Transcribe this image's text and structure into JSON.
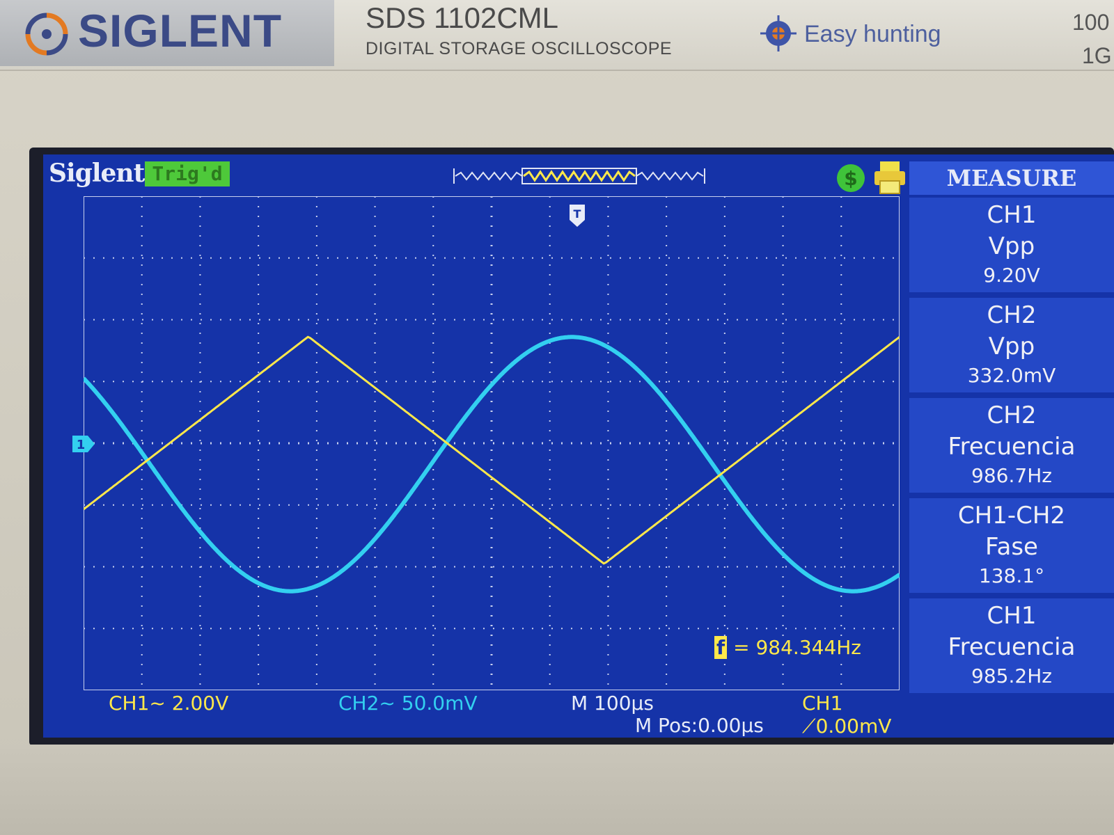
{
  "device": {
    "brand": "SIGLENT",
    "model": "SDS 1102CML",
    "subtitle": "DIGITAL STORAGE OSCILLOSCOPE",
    "feature": "Easy hunting",
    "corner_top": "100",
    "corner_bottom": "1G"
  },
  "screen": {
    "logo": "Siglent",
    "trigger_status": "Trig'd",
    "trigger_marker": "T",
    "ch1_ground_marker": "1",
    "freq_counter": "984.344Hz",
    "freq_counter_icon": "f"
  },
  "measure": {
    "title": "MEASURE",
    "items": [
      {
        "source": "CH1",
        "name": "Vpp",
        "value": "9.20V"
      },
      {
        "source": "CH2",
        "name": "Vpp",
        "value": "332.0mV"
      },
      {
        "source": "CH2",
        "name": "Frecuencia",
        "value": "986.7Hz"
      },
      {
        "source": "CH1-CH2",
        "name": "Fase",
        "value": "138.1°"
      },
      {
        "source": "CH1",
        "name": "Frecuencia",
        "value": "985.2Hz"
      }
    ]
  },
  "status": {
    "ch1_scale": "CH1~ 2.00V",
    "ch2_scale": "CH2~ 50.0mV",
    "timebase": "M 100μs",
    "position": "M Pos:0.00μs",
    "trigger": "CH1 ⟋0.00mV"
  },
  "colors": {
    "ch1": "#ffe84a",
    "ch2": "#33d0f0",
    "screen_bg": "#1533a8",
    "grid": "#c8d0ee"
  },
  "waveforms": {
    "grid_divisions": {
      "x": 14,
      "y": 8
    },
    "ch1": {
      "shape": "triangle",
      "volts_per_div": 2.0,
      "vpp": 9.2,
      "frequency_hz": 985.2
    },
    "ch2": {
      "shape": "sine",
      "volts_per_div": 0.05,
      "vpp": 0.332,
      "frequency_hz": 986.7
    }
  }
}
